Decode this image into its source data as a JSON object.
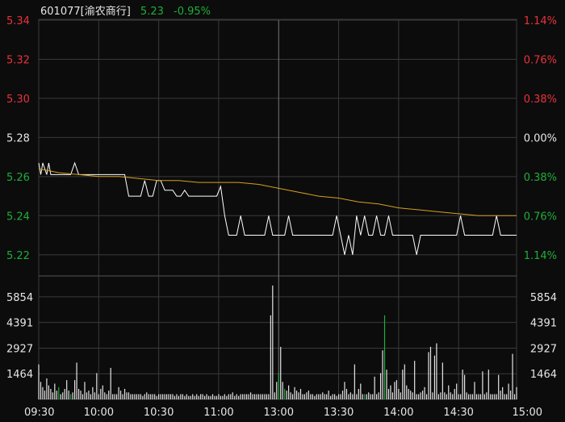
{
  "header": {
    "code_name": "601077[渝农商行]",
    "price": "5.23",
    "change_pct": "-0.95%"
  },
  "colors": {
    "up": "#e8323c",
    "down": "#1fae3a",
    "neutral": "#e6e6e6",
    "avg_line": "#d6a01e",
    "grid": "#3a3a3a",
    "price_line": "#ffffff"
  },
  "chart_data": [
    {
      "type": "line",
      "title": "",
      "prev_close": 5.28,
      "ylim": [
        5.21,
        5.34
      ],
      "y_ticks": [
        5.34,
        5.32,
        5.3,
        5.28,
        5.26,
        5.24,
        5.22
      ],
      "right_ticks": [
        "1.14%",
        "0.76%",
        "0.38%",
        "0.00%",
        "0.38%",
        "0.76%",
        "1.14%"
      ],
      "x_ticks": [
        "09:30",
        "10:00",
        "10:30",
        "11:00",
        "13:00",
        "13:30",
        "14:00",
        "14:30",
        "15:00"
      ],
      "series": [
        {
          "role": "price",
          "x": [
            0,
            1,
            2,
            4,
            5,
            6,
            8,
            10,
            12,
            14,
            16,
            18,
            20,
            22,
            24,
            26,
            27,
            29,
            31,
            33,
            35,
            37,
            39,
            41,
            43,
            45,
            47,
            49,
            51,
            53,
            55,
            57,
            59,
            60,
            61,
            63,
            65,
            67,
            69,
            71,
            73,
            75,
            77,
            79,
            81,
            83,
            85,
            87,
            89,
            91,
            93,
            95,
            97,
            99,
            101,
            103,
            105,
            107,
            109,
            111,
            113,
            115,
            117,
            119,
            121,
            123,
            125,
            127,
            129,
            131,
            133,
            135,
            137,
            139,
            141,
            143,
            145,
            147,
            149,
            151,
            153,
            155,
            157,
            159,
            161,
            163,
            165,
            167,
            169,
            171,
            173,
            175,
            177,
            179,
            181,
            183,
            185,
            187,
            189,
            191,
            193,
            195,
            197,
            199,
            201,
            203,
            205,
            207,
            209,
            211,
            213,
            215,
            217,
            219,
            221,
            223,
            225,
            227,
            229,
            231,
            233,
            235,
            237,
            239
          ],
          "y": [
            5.267,
            5.261,
            5.267,
            5.261,
            5.267,
            5.261,
            5.261,
            5.261,
            5.261,
            5.261,
            5.261,
            5.267,
            5.261,
            5.261,
            5.261,
            5.261,
            5.261,
            5.261,
            5.261,
            5.261,
            5.261,
            5.261,
            5.261,
            5.261,
            5.261,
            5.25,
            5.25,
            5.25,
            5.25,
            5.258,
            5.25,
            5.25,
            5.258,
            5.258,
            5.258,
            5.253,
            5.253,
            5.253,
            5.25,
            5.25,
            5.253,
            5.25,
            5.25,
            5.25,
            5.25,
            5.25,
            5.25,
            5.25,
            5.25,
            5.255,
            5.24,
            5.23,
            5.23,
            5.23,
            5.24,
            5.23,
            5.23,
            5.23,
            5.23,
            5.23,
            5.23,
            5.24,
            5.23,
            5.23,
            5.23,
            5.23,
            5.24,
            5.23,
            5.23,
            5.23,
            5.23,
            5.23,
            5.23,
            5.23,
            5.23,
            5.23,
            5.23,
            5.23,
            5.24,
            5.23,
            5.22,
            5.23,
            5.22,
            5.24,
            5.23,
            5.24,
            5.23,
            5.23,
            5.24,
            5.23,
            5.23,
            5.24,
            5.23,
            5.23,
            5.23,
            5.23,
            5.23,
            5.23,
            5.22,
            5.23,
            5.23,
            5.23,
            5.23,
            5.23,
            5.23,
            5.23,
            5.23,
            5.23,
            5.23,
            5.24,
            5.23,
            5.23,
            5.23,
            5.23,
            5.23,
            5.23,
            5.23,
            5.23,
            5.24,
            5.23,
            5.23,
            5.23,
            5.23,
            5.23
          ]
        },
        {
          "role": "average",
          "x": [
            0,
            10,
            20,
            30,
            40,
            50,
            60,
            70,
            80,
            90,
            100,
            110,
            120,
            130,
            140,
            150,
            160,
            170,
            180,
            190,
            200,
            210,
            220,
            230,
            239
          ],
          "y": [
            5.264,
            5.262,
            5.261,
            5.26,
            5.26,
            5.259,
            5.258,
            5.258,
            5.257,
            5.257,
            5.257,
            5.256,
            5.254,
            5.252,
            5.25,
            5.249,
            5.247,
            5.246,
            5.244,
            5.243,
            5.242,
            5.241,
            5.24,
            5.24,
            5.24
          ]
        }
      ]
    },
    {
      "type": "bar",
      "title": "",
      "y_ticks": [
        5854,
        4391,
        2927,
        1464
      ],
      "ylim": [
        0,
        7000
      ],
      "x": [
        0,
        1,
        2,
        3,
        4,
        5,
        6,
        7,
        8,
        9,
        10,
        11,
        12,
        13,
        14,
        15,
        16,
        17,
        18,
        19,
        20,
        21,
        22,
        23,
        24,
        25,
        26,
        27,
        28,
        29,
        30,
        31,
        32,
        33,
        34,
        35,
        36,
        37,
        38,
        39,
        40,
        41,
        42,
        43,
        44,
        45,
        46,
        47,
        48,
        49,
        50,
        51,
        52,
        53,
        54,
        55,
        56,
        57,
        58,
        59,
        60,
        61,
        62,
        63,
        64,
        65,
        66,
        67,
        68,
        69,
        70,
        71,
        72,
        73,
        74,
        75,
        76,
        77,
        78,
        79,
        80,
        81,
        82,
        83,
        84,
        85,
        86,
        87,
        88,
        89,
        90,
        91,
        92,
        93,
        94,
        95,
        96,
        97,
        98,
        99,
        100,
        101,
        102,
        103,
        104,
        105,
        106,
        107,
        108,
        109,
        110,
        111,
        112,
        113,
        114,
        115,
        116,
        117,
        118,
        119,
        120,
        121,
        122,
        123,
        124,
        125,
        126,
        127,
        128,
        129,
        130,
        131,
        132,
        133,
        134,
        135,
        136,
        137,
        138,
        139,
        140,
        141,
        142,
        143,
        144,
        145,
        146,
        147,
        148,
        149,
        150,
        151,
        152,
        153,
        154,
        155,
        156,
        157,
        158,
        159,
        160,
        161,
        162,
        163,
        164,
        165,
        166,
        167,
        168,
        169,
        170,
        171,
        172,
        173,
        174,
        175,
        176,
        177,
        178,
        179,
        180,
        181,
        182,
        183,
        184,
        185,
        186,
        187,
        188,
        189,
        190,
        191,
        192,
        193,
        194,
        195,
        196,
        197,
        198,
        199,
        200,
        201,
        202,
        203,
        204,
        205,
        206,
        207,
        208,
        209,
        210,
        211,
        212,
        213,
        214,
        215,
        216,
        217,
        218,
        219,
        220,
        221,
        222,
        223,
        224,
        225,
        226,
        227,
        228,
        229,
        230,
        231,
        232,
        233,
        234,
        235,
        236,
        237,
        238,
        239
      ],
      "values": [
        2000,
        1000,
        700,
        500,
        1200,
        800,
        600,
        400,
        900,
        500,
        700,
        300,
        400,
        600,
        1100,
        500,
        300,
        400,
        1100,
        2100,
        600,
        500,
        300,
        1000,
        400,
        500,
        300,
        700,
        400,
        1500,
        300,
        600,
        800,
        400,
        300,
        500,
        1800,
        300,
        300,
        300,
        700,
        500,
        300,
        600,
        400,
        400,
        300,
        300,
        300,
        300,
        300,
        300,
        200,
        300,
        400,
        300,
        300,
        300,
        300,
        200,
        300,
        300,
        300,
        300,
        300,
        300,
        300,
        300,
        200,
        300,
        200,
        300,
        300,
        200,
        300,
        200,
        200,
        300,
        200,
        300,
        200,
        300,
        300,
        200,
        300,
        200,
        200,
        300,
        200,
        200,
        300,
        200,
        200,
        300,
        200,
        300,
        300,
        400,
        200,
        300,
        200,
        300,
        300,
        300,
        300,
        300,
        400,
        300,
        300,
        300,
        300,
        300,
        300,
        300,
        300,
        300,
        4800,
        6500,
        400,
        1000,
        1500,
        3000,
        1000,
        600,
        500,
        800,
        400,
        300,
        700,
        500,
        400,
        600,
        300,
        300,
        400,
        500,
        300,
        300,
        200,
        300,
        300,
        300,
        400,
        300,
        300,
        500,
        200,
        300,
        300,
        200,
        300,
        300,
        500,
        1000,
        600,
        300,
        400,
        300,
        2000,
        300,
        600,
        900,
        300,
        300,
        300,
        400,
        300,
        300,
        1300,
        300,
        400,
        1500,
        2800,
        4800,
        1700,
        600,
        800,
        400,
        1000,
        1100,
        600,
        400,
        1700,
        2000,
        800,
        600,
        500,
        400,
        2200,
        300,
        300,
        400,
        500,
        700,
        300,
        2700,
        3000,
        400,
        2500,
        3200,
        300,
        400,
        2100,
        400,
        300,
        800,
        400,
        300,
        600,
        900,
        300,
        300,
        1700,
        1400,
        400,
        300,
        300,
        300,
        1000,
        300,
        300,
        300,
        1600,
        300,
        400,
        1700,
        300,
        300,
        300,
        300,
        1400,
        500,
        700,
        300,
        300,
        900,
        500,
        2600,
        300,
        700,
        300,
        300
      ],
      "directions": [
        "n",
        "n",
        "n",
        "n",
        "n",
        "n",
        "n",
        "n",
        "n",
        "n",
        "d",
        "n",
        "n",
        "n",
        "n",
        "n",
        "d",
        "n",
        "n",
        "n",
        "n",
        "n",
        "n",
        "n",
        "n",
        "n",
        "n",
        "n",
        "n",
        "n",
        "n",
        "n",
        "n",
        "n",
        "n",
        "n",
        "n",
        "n",
        "n",
        "n",
        "n",
        "n",
        "n",
        "n",
        "n",
        "n",
        "n",
        "n",
        "n",
        "n",
        "n",
        "n",
        "n",
        "n",
        "n",
        "n",
        "n",
        "n",
        "n",
        "n",
        "n",
        "n",
        "n",
        "n",
        "n",
        "n",
        "n",
        "n",
        "n",
        "n",
        "n",
        "n",
        "n",
        "n",
        "n",
        "n",
        "n",
        "n",
        "n",
        "n",
        "n",
        "n",
        "n",
        "n",
        "n",
        "n",
        "n",
        "n",
        "n",
        "n",
        "n",
        "n",
        "n",
        "n",
        "n",
        "n",
        "n",
        "n",
        "n",
        "n",
        "n",
        "n",
        "n",
        "n",
        "n",
        "n",
        "n",
        "n",
        "n",
        "n",
        "n",
        "n",
        "n",
        "n",
        "n",
        "n",
        "n",
        "n",
        "n",
        "n",
        "d",
        "n",
        "n",
        "d",
        "n",
        "n",
        "n",
        "n",
        "n",
        "n",
        "n",
        "n",
        "n",
        "n",
        "n",
        "n",
        "n",
        "n",
        "n",
        "n",
        "n",
        "n",
        "n",
        "n",
        "n",
        "n",
        "n",
        "n",
        "n",
        "n",
        "n",
        "n",
        "n",
        "n",
        "n",
        "n",
        "n",
        "n",
        "n",
        "n",
        "n",
        "n",
        "n",
        "d",
        "n",
        "n",
        "n",
        "n",
        "n",
        "n",
        "n",
        "n",
        "n",
        "d",
        "n",
        "n",
        "n",
        "n",
        "n",
        "n",
        "n",
        "n",
        "n",
        "n",
        "n",
        "n",
        "n",
        "n",
        "n",
        "n",
        "n",
        "n",
        "n",
        "n",
        "n",
        "n",
        "n",
        "n",
        "n",
        "n",
        "n",
        "n",
        "n",
        "n",
        "n",
        "n",
        "n",
        "n",
        "n",
        "n",
        "n",
        "n",
        "n",
        "n",
        "n",
        "n",
        "n",
        "n",
        "n",
        "n",
        "n",
        "n",
        "n",
        "n",
        "n",
        "n",
        "n",
        "n",
        "n",
        "n",
        "n",
        "n",
        "n",
        "n",
        "n",
        "n",
        "n",
        "n",
        "n",
        "n",
        "n",
        "n",
        "n",
        "n"
      ]
    }
  ]
}
